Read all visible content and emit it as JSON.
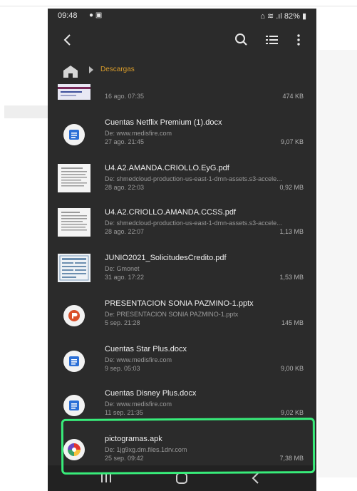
{
  "status": {
    "time": "09:48",
    "battery": "82%"
  },
  "breadcrumb": {
    "folder": "Descargas"
  },
  "files": [
    {
      "title": "",
      "subtitle": "",
      "date": "16 ago. 07:35",
      "size": "474 KB",
      "thumb": "image"
    },
    {
      "title": "Cuentas Netflix Premium (1).docx",
      "subtitle": "De: www.medisfire.com",
      "date": "27 ago. 21:45",
      "size": "9,07 KB",
      "thumb": "word"
    },
    {
      "title": "U4.A2.AMANDA.CRIOLLO.EyG.pdf",
      "subtitle": "De: shmedcloud-production-us-east-1-dmn-assets.s3-accele...",
      "date": "28 ago. 22:03",
      "size": "0,92 MB",
      "thumb": "doc"
    },
    {
      "title": "U4.A2.CRIOLLO.AMANDA.CCSS.pdf",
      "subtitle": "De: shmedcloud-production-us-east-1-dmn-assets.s3-accele...",
      "date": "28 ago. 22:07",
      "size": "1,13 MB",
      "thumb": "doc"
    },
    {
      "title": "JUNIO2021_SolicitudesCredito.pdf",
      "subtitle": "De: Gmonet",
      "date": "31 ago. 17:22",
      "size": "1,53 MB",
      "thumb": "form"
    },
    {
      "title": "PRESENTACION SONIA PAZMINO-1.pptx",
      "subtitle": "De: PRESENTACION SONIA PAZMINO-1.pptx",
      "date": "5 sep. 21:28",
      "size": "145 MB",
      "thumb": "ppt"
    },
    {
      "title": "Cuentas Star Plus.docx",
      "subtitle": "De: www.medisfire.com",
      "date": "9 sep. 05:03",
      "size": "9,00 KB",
      "thumb": "word"
    },
    {
      "title": "Cuentas Disney Plus.docx",
      "subtitle": "De: www.medisfire.com",
      "date": "11 sep. 21:35",
      "size": "9,02 KB",
      "thumb": "word"
    },
    {
      "title": "pictogramas.apk",
      "subtitle": "De: 1jg9xg.dm.files.1drv.com",
      "date": "25 sep. 09:42",
      "size": "7,38 MB",
      "thumb": "apk"
    }
  ],
  "colors": {
    "accent": "#d79b2b",
    "highlight": "#38ec7a",
    "background": "#2b2b2b"
  },
  "icons": {
    "back": "arrow-left-icon",
    "search": "search-icon",
    "list": "list-view-icon",
    "more": "more-vert-icon",
    "home": "home-icon"
  }
}
